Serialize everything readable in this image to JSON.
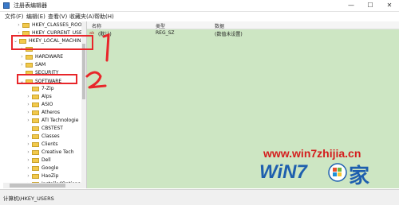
{
  "window": {
    "title": "注册表编辑器",
    "minimize_glyph": "—",
    "maximize_glyph": "☐",
    "close_glyph": "✕"
  },
  "menu": [
    "文件(F)",
    "编辑(E)",
    "查看(V)",
    "收藏夹(A)",
    "帮助(H)"
  ],
  "tree": [
    {
      "label": "HKEY_CLASSES_ROOT",
      "toggle": "›"
    },
    {
      "label": "HKEY_CURRENT_USER",
      "toggle": "›"
    },
    {
      "label": "HKEY_LOCAL_MACHINE",
      "toggle": "⌄"
    },
    {
      "label": "HARDWARE",
      "toggle": "›"
    },
    {
      "label": "SAM",
      "toggle": "›"
    },
    {
      "label": "SECURITY",
      "toggle": ""
    },
    {
      "label": "SOFTWARE",
      "toggle": "⌄"
    },
    {
      "label": "7-Zip",
      "toggle": ""
    },
    {
      "label": "Alps",
      "toggle": "›"
    },
    {
      "label": "ASIO",
      "toggle": "›"
    },
    {
      "label": "Atheros",
      "toggle": "›"
    },
    {
      "label": "ATI Technologie",
      "toggle": "›"
    },
    {
      "label": "CBSTEST",
      "toggle": ""
    },
    {
      "label": "Classes",
      "toggle": "›"
    },
    {
      "label": "Clients",
      "toggle": "›"
    },
    {
      "label": "Creative Tech",
      "toggle": "›"
    },
    {
      "label": "Dell",
      "toggle": "›"
    },
    {
      "label": "Google",
      "toggle": "›"
    },
    {
      "label": "HaoZip",
      "toggle": "›"
    },
    {
      "label": "InstalledOptions",
      "toggle": "›"
    }
  ],
  "columns": {
    "name": "名称",
    "type": "类型",
    "data": "数据"
  },
  "values": [
    {
      "name": "(默认)",
      "type": "REG_SZ",
      "data": "(数值未设置)"
    }
  ],
  "status": "计算机\\HKEY_USERS",
  "annotations": {
    "one": "1",
    "two": "2"
  },
  "watermark": {
    "url": "www.win7zhijia.cn",
    "logo_text": "WiN7",
    "logo_suffix": "家"
  },
  "colors": {
    "annotation": "#e8262a",
    "value_pane": "#cde6c3",
    "watermark": "#d41d1d"
  }
}
